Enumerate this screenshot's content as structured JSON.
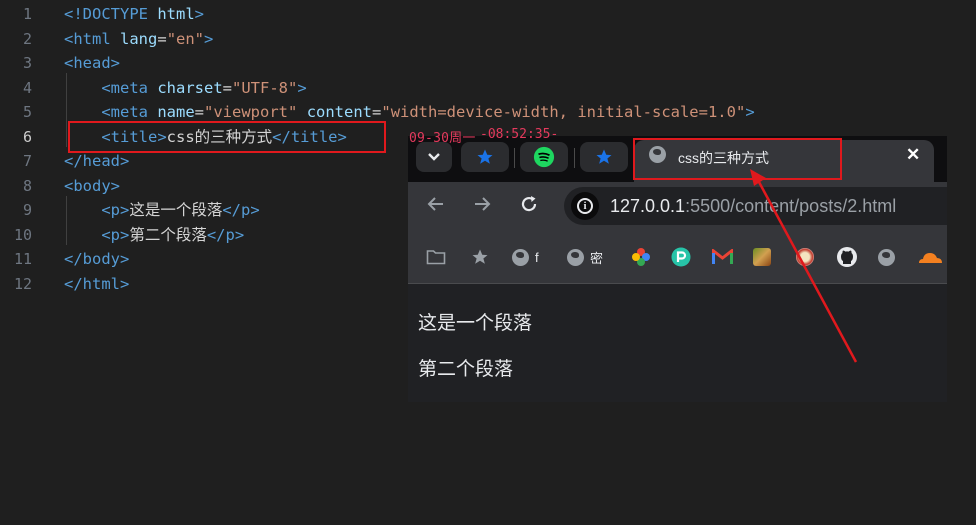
{
  "editor": {
    "line_numbers": [
      "1",
      "2",
      "3",
      "4",
      "5",
      "6",
      "7",
      "8",
      "9",
      "10",
      "11",
      "12"
    ],
    "lines": [
      {
        "parts": [
          [
            "tag",
            "<!"
          ],
          [
            "tag",
            "DOCTYPE"
          ],
          [
            "txt",
            " "
          ],
          [
            "attr",
            "html"
          ],
          [
            "tag",
            ">"
          ]
        ]
      },
      {
        "parts": [
          [
            "tag",
            "<html"
          ],
          [
            "txt",
            " "
          ],
          [
            "attr",
            "lang"
          ],
          [
            "txt",
            "="
          ],
          [
            "str",
            "\"en\""
          ],
          [
            "tag",
            ">"
          ]
        ]
      },
      {
        "parts": [
          [
            "tag",
            "<head>"
          ]
        ]
      },
      {
        "parts": [
          [
            "txt",
            "    "
          ],
          [
            "tag",
            "<meta"
          ],
          [
            "txt",
            " "
          ],
          [
            "attr",
            "charset"
          ],
          [
            "txt",
            "="
          ],
          [
            "str",
            "\"UTF-8\""
          ],
          [
            "tag",
            ">"
          ]
        ]
      },
      {
        "parts": [
          [
            "txt",
            "    "
          ],
          [
            "tag",
            "<meta"
          ],
          [
            "txt",
            " "
          ],
          [
            "attr",
            "name"
          ],
          [
            "txt",
            "="
          ],
          [
            "str",
            "\"viewport\""
          ],
          [
            "txt",
            " "
          ],
          [
            "attr",
            "content"
          ],
          [
            "txt",
            "="
          ],
          [
            "str",
            "\"width=device-width, initial-scale=1.0\""
          ],
          [
            "tag",
            ">"
          ]
        ]
      },
      {
        "parts": [
          [
            "txt",
            "    "
          ],
          [
            "tag",
            "<title>"
          ],
          [
            "txt",
            "css的三种方式"
          ],
          [
            "tag",
            "</title>"
          ]
        ]
      },
      {
        "parts": [
          [
            "tag",
            "</head>"
          ]
        ]
      },
      {
        "parts": [
          [
            "tag",
            "<body>"
          ]
        ]
      },
      {
        "parts": [
          [
            "txt",
            "    "
          ],
          [
            "tag",
            "<p>"
          ],
          [
            "txt",
            "这是一个段落"
          ],
          [
            "tag",
            "</p>"
          ]
        ]
      },
      {
        "parts": [
          [
            "txt",
            "    "
          ],
          [
            "tag",
            "<p>"
          ],
          [
            "txt",
            "第二个段落"
          ],
          [
            "tag",
            "</p>"
          ]
        ]
      },
      {
        "parts": [
          [
            "tag",
            "</body>"
          ]
        ]
      },
      {
        "parts": [
          [
            "tag",
            "</html>"
          ]
        ]
      }
    ],
    "current_line": "6"
  },
  "overlay": {
    "clock_date": "09-30周一",
    "clock_time": "-08:52:35-"
  },
  "browser": {
    "tabs": {
      "menu_icon": "chevron-down-icon",
      "active_title": "css的三种方式",
      "close_glyph": "✕"
    },
    "url": {
      "host": "127.0.0.1",
      "path": ":5500/content/posts/2.html"
    },
    "bookmarks": [
      {
        "icon": "folder-icon",
        "label": ""
      },
      {
        "icon": "star-icon",
        "label": ""
      },
      {
        "icon": "globe-icon",
        "label": "f"
      },
      {
        "icon": "globe-icon",
        "label": "密"
      },
      {
        "icon": "photos-icon",
        "label": ""
      },
      {
        "icon": "p-icon",
        "label": ""
      },
      {
        "icon": "gmail-icon",
        "label": ""
      },
      {
        "icon": "image-icon",
        "label": ""
      },
      {
        "icon": "image-icon",
        "label": ""
      },
      {
        "icon": "github-icon",
        "label": ""
      },
      {
        "icon": "globe-icon",
        "label": ""
      },
      {
        "icon": "cloudflare-icon",
        "label": ""
      }
    ],
    "page": {
      "paragraphs": [
        "这是一个段落",
        "第二个段落"
      ]
    }
  },
  "colors": {
    "highlight": "#e0191d",
    "tag": "#569cd6",
    "attr": "#9cdcfe",
    "string": "#ce9178",
    "spotify": "#1ed760",
    "star": "#1a73e8"
  }
}
